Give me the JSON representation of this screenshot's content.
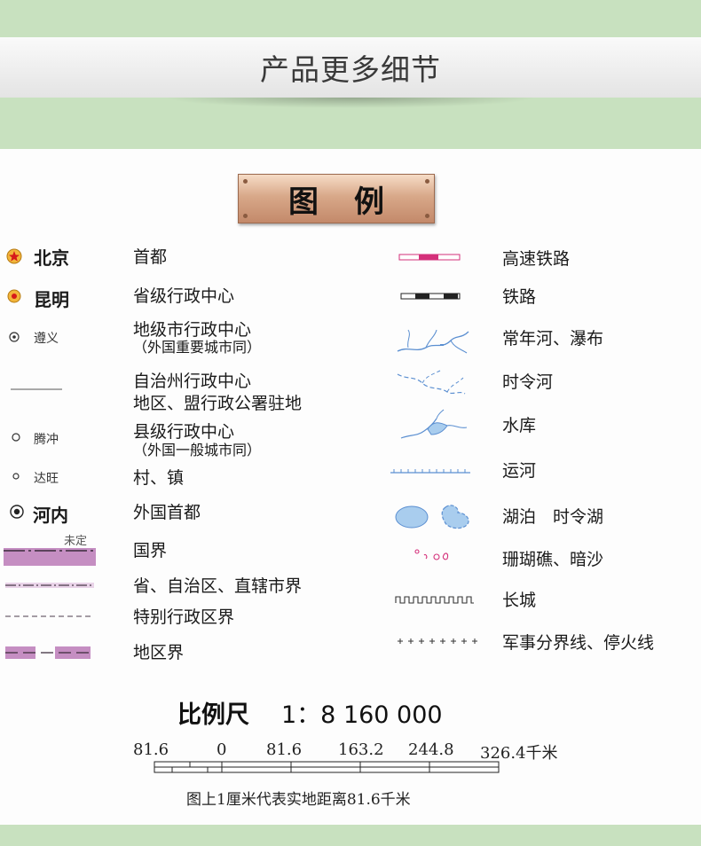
{
  "header": {
    "title": "产品更多细节"
  },
  "legend": {
    "title": "图例",
    "left_column": [
      {
        "symbol": "star-capital-icon",
        "name": "北京",
        "desc": "首都"
      },
      {
        "symbol": "double-dot-provincial-icon",
        "name": "昆明",
        "desc": "省级行政中心"
      },
      {
        "symbol": "ring-dot-prefecture-icon",
        "name": "遵义",
        "desc": "地级市行政中心",
        "desc2": "（外国重要城市同）"
      },
      {
        "symbol": "thin-line-icon",
        "name": "",
        "desc": "自治州行政中心",
        "desc2": "地区、盟行政公署驻地"
      },
      {
        "symbol": "small-ring-county-icon",
        "name": "腾冲",
        "desc": "县级行政中心",
        "desc2": "（外国一般城市同）"
      },
      {
        "symbol": "small-circle-village-icon",
        "name": "达旺",
        "desc": "村、镇"
      },
      {
        "symbol": "double-ring-foreign-capital-icon",
        "name": "河内",
        "desc": "外国首都"
      },
      {
        "symbol": "national-border-icon",
        "name": "未定",
        "desc": "国界"
      },
      {
        "symbol": "provincial-border-icon",
        "name": "",
        "desc": "省、自治区、直辖市界"
      },
      {
        "symbol": "special-region-border-icon",
        "name": "",
        "desc": "特别行政区界"
      },
      {
        "symbol": "region-border-icon",
        "name": "",
        "desc": "地区界"
      }
    ],
    "right_column": [
      {
        "symbol": "expressway-icon",
        "desc": "高速铁路"
      },
      {
        "symbol": "railway-icon",
        "desc": "铁路"
      },
      {
        "symbol": "river-waterfall-icon",
        "desc": "常年河、瀑布"
      },
      {
        "symbol": "seasonal-river-icon",
        "desc": "时令河"
      },
      {
        "symbol": "reservoir-icon",
        "desc": "水库"
      },
      {
        "symbol": "canal-icon",
        "desc": "运河"
      },
      {
        "symbol": "lake-icon",
        "desc": "湖泊　时令湖"
      },
      {
        "symbol": "coral-reef-icon",
        "desc": "珊瑚礁、暗沙"
      },
      {
        "symbol": "great-wall-icon",
        "desc": "长城"
      },
      {
        "symbol": "military-line-icon",
        "desc": "军事分界线、停火线"
      }
    ]
  },
  "scale": {
    "title": "比例尺",
    "ratio": "1：8 160 000",
    "ticks": [
      "81.6",
      "0",
      "81.6",
      "163.2",
      "244.8",
      "326.4千米"
    ],
    "note": "图上1厘米代表实地距离81.6千米"
  },
  "colors": {
    "page_green": "#c8e1bf",
    "border_purple": "#c58ec2",
    "water_blue": "#5b8fd1",
    "lake_fill": "#a9cdee",
    "capital_red": "#d61a1a",
    "expressway_pink": "#d4307a"
  }
}
